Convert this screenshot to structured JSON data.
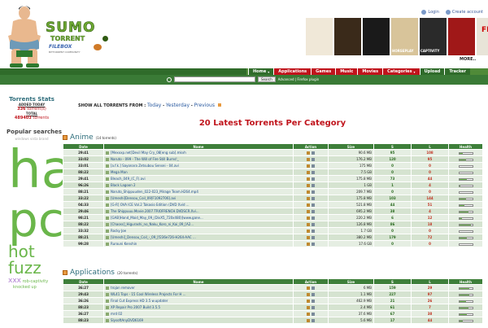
{
  "header": {
    "logo_main": "SUMO",
    "logo_torrent": "TORRENT",
    "logo_sub": "FILEBOX",
    "logo_sub_small": "BITTORRENT COMMUNITY",
    "login_label": "Login",
    "create_account_label": "Create account",
    "posters": [
      {
        "title": "",
        "color": "#f0e8d8"
      },
      {
        "title": "",
        "color": "#3a2a1a"
      },
      {
        "title": "",
        "color": "#1a1a1a"
      },
      {
        "title": "HORSEPLAY",
        "color": "#d8c49a"
      },
      {
        "title": "CAPTIVITY",
        "color": "#2a2a2a"
      },
      {
        "title": "",
        "color": "#a01818"
      },
      {
        "title": "FIDO",
        "color": "#e8e4d8"
      }
    ],
    "more_label": "MORE.."
  },
  "nav": {
    "items": [
      {
        "label": "Home",
        "style": "dark",
        "chevron": true
      },
      {
        "label": "Applications",
        "style": "red",
        "chevron": false
      },
      {
        "label": "Games",
        "style": "red",
        "chevron": false
      },
      {
        "label": "Music",
        "style": "red",
        "chevron": false
      },
      {
        "label": "Movies",
        "style": "red",
        "chevron": false
      },
      {
        "label": "Categories",
        "style": "red",
        "chevron": true
      },
      {
        "label": "Upload",
        "style": "dark",
        "chevron": false
      },
      {
        "label": "Tracker",
        "style": "dark",
        "chevron": false
      }
    ]
  },
  "search": {
    "placeholder": "",
    "button_label": "Search",
    "advanced_label": "Advanced | Firefox plugin"
  },
  "sidebar": {
    "stats_title": "Torrents Stats",
    "added_today_label": "ADDED TODAY",
    "added_today_value": "336",
    "added_today_unit": "torrent(s)",
    "total_label": "TOTAL",
    "total_value": "489403",
    "total_unit": "torrents",
    "popular_title": "Popular searches",
    "popular_sub": "windows vista brand",
    "cloud": [
      {
        "text": "ha",
        "size": 64,
        "color": "#6ab64a"
      },
      {
        "text": "pc",
        "size": 58,
        "color": "#6ab64a"
      },
      {
        "text": "hot",
        "size": 20,
        "color": "#6ab64a"
      },
      {
        "text": "fuzz",
        "size": 20,
        "color": "#6ab64a"
      }
    ],
    "cloud_last": {
      "big": "xxx",
      "small": "rob-captivity",
      "next": "knocked up"
    }
  },
  "main": {
    "show_all_label": "SHOW ALL TORRENTS FROM :",
    "filters": [
      "Today",
      "Yesterday",
      "Previous"
    ],
    "title": "20 Latest Torrents Per Category"
  },
  "columns": [
    "Date",
    "Name",
    "Action",
    "Size",
    "S",
    "L",
    "Health"
  ],
  "sections": [
    {
      "title": "Anime",
      "count_label": "(14 torrents)",
      "rows": [
        {
          "date": "29:41",
          "name": "[Mexxxp.net]Devil May Cry_08[eng sub].mkvh",
          "size": "90.6 MB",
          "seed": "95",
          "leech": "108",
          "health": 0.3
        },
        {
          "date": "33:02",
          "name": "Naruto - 099 - The Will of Fire Still Burns!_",
          "size": "176.2 MB",
          "seed": "120",
          "leech": "95",
          "health": 0.5
        },
        {
          "date": "33:01",
          "name": "[a.f.k.] Sayonara Zetsubou Sensei - 04.avi",
          "size": "175 MB",
          "seed": "0",
          "leech": "0",
          "health": 0.0
        },
        {
          "date": "88:22",
          "name": "Mega Man",
          "size": "7.5 GB",
          "seed": "0",
          "leech": "0",
          "health": 0.0
        },
        {
          "date": "29:41",
          "name": "Bleach_049_(C_F).avi",
          "size": "175.8 MB",
          "seed": "73",
          "leech": "44",
          "health": 0.6
        },
        {
          "date": "96:26",
          "name": "Black Lagoon 2",
          "size": "1 GB",
          "seed": "1",
          "leech": "4",
          "health": 0.1
        },
        {
          "date": "88:21",
          "name": "Naruto_Shippuuden_022-023_Mirage Team.H264.mp4",
          "size": "209.7 MB",
          "seed": "0",
          "leech": "0",
          "health": 0.0
        },
        {
          "date": "33:22",
          "name": "[Umeshi]Densou_Coil_09[F1092706].avi",
          "size": "175.8 MB",
          "seed": "103",
          "leech": "144",
          "health": 0.5
        },
        {
          "date": "04:33",
          "name": "[G-R] OVA ICE Vol.2 Takasio Edition (DVD Xvid ...",
          "size": "521.8 MB",
          "seed": "44",
          "leech": "51",
          "health": 0.4
        },
        {
          "date": "29:46",
          "name": "The Shippuuu.Movie.2007.TRIOFRENCH.DVDSCR.Xvi...",
          "size": "695.2 MB",
          "seed": "38",
          "leech": "4",
          "health": 0.7
        },
        {
          "date": "98:21",
          "name": "[GAB]Hand_Maid_May_09_(DivX5_720x480)[www.gane...",
          "size": "220.2 MB",
          "seed": "6",
          "leech": "12",
          "health": 0.2
        },
        {
          "date": "88:22",
          "name": "[Chaoss]_Higurashi_no_Naku_Koro_ni_Kai_09_[A2...",
          "size": "126.8 MB",
          "seed": "86",
          "leech": "18",
          "health": 0.9
        },
        {
          "date": "33:32",
          "name": "Rocky Joe",
          "size": "1.7 GB",
          "seed": "0",
          "leech": "0",
          "health": 0.0
        },
        {
          "date": "88:21",
          "name": "[Umeshi]_Densou_Coil_-_09_[f236e726-H264-AAC ...",
          "size": "380.2 MB",
          "seed": "179",
          "leech": "72",
          "health": 0.6
        },
        {
          "date": "99:28",
          "name": "Rurouni Kenshin",
          "size": "17.6 GB",
          "seed": "0",
          "leech": "0",
          "health": 0.0
        }
      ]
    },
    {
      "title": "Applications",
      "count_label": "(20 torrents)",
      "rows": [
        {
          "date": "36:27",
          "name": "trojan remover",
          "size": "6 MB",
          "seed": "159",
          "leech": "29",
          "health": 0.8
        },
        {
          "date": "29:43",
          "name": "WL41 Tops - 15 Cool Wireless Projects For H ...",
          "size": "1.1 MB",
          "seed": "227",
          "leech": "97",
          "health": 0.8
        },
        {
          "date": "36:26",
          "name": "Final Cut Express HD 3.5 w.updater",
          "size": "462.9 MB",
          "seed": "21",
          "leech": "26",
          "health": 0.5
        },
        {
          "date": "88:23",
          "name": "XP Repair Pro 2007 Build 3.5.5",
          "size": "2.4 MB",
          "seed": "61",
          "leech": "7",
          "health": 0.7
        },
        {
          "date": "36:27",
          "name": "mrd 02",
          "size": "37.6 MB",
          "seed": "67",
          "leech": "38",
          "health": 0.6
        },
        {
          "date": "88:23",
          "name": "SlysoftAnyDVD6169",
          "size": "5.6 MB",
          "seed": "17",
          "leech": "44",
          "health": 0.3
        }
      ]
    }
  ]
}
